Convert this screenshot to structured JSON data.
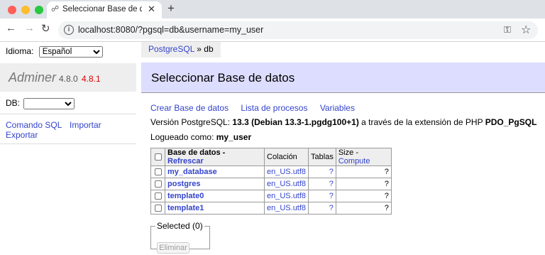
{
  "browser": {
    "tab_title": "Seleccionar Base de datos - d",
    "tab_close": "✕",
    "new_tab": "+",
    "url": "localhost:8080/?pgsql=db&username=my_user",
    "icons": [
      "back-icon",
      "forward-icon",
      "reload-icon",
      "site-info-icon",
      "key-icon",
      "bookmark-star-icon"
    ]
  },
  "menu": {
    "language_label": "Idioma:",
    "language_selected": "Español",
    "brand_name": "Adminer",
    "version_current": "4.8.0",
    "version_new": "4.8.1",
    "db_label": "DB:",
    "db_selected": "",
    "links": {
      "sql_command": "Comando SQL",
      "import": "Importar",
      "export": "Exportar"
    }
  },
  "breadcrumb": {
    "driver": "PostgreSQL",
    "separator": "»",
    "server": "db"
  },
  "main": {
    "title": "Seleccionar Base de datos",
    "links": {
      "create_db": "Crear Base de datos",
      "process_list": "Lista de procesos",
      "variables": "Variables"
    },
    "version_prefix": "Versión PostgreSQL:",
    "version_value": "13.3 (Debian 13.3-1.pgdg100+1)",
    "version_middle": "a través de la extensión de PHP",
    "version_ext": "PDO_PgSQL",
    "login_label": "Logueado como:",
    "login_user": "my_user"
  },
  "table": {
    "headers": {
      "database": "Base de datos",
      "dash": "-",
      "refresh": "Refrescar",
      "collation": "Colación",
      "tables": "Tablas",
      "size": "Size",
      "size_dash": "-",
      "compute": "Compute"
    },
    "rows": [
      {
        "name": "my_database",
        "collation": "en_US.utf8",
        "tables": "?",
        "size": "?"
      },
      {
        "name": "postgres",
        "collation": "en_US.utf8",
        "tables": "?",
        "size": "?"
      },
      {
        "name": "template0",
        "collation": "en_US.utf8",
        "tables": "?",
        "size": "?"
      },
      {
        "name": "template1",
        "collation": "en_US.utf8",
        "tables": "?",
        "size": "?"
      }
    ]
  },
  "selected": {
    "legend": "Selected (0)",
    "delete_button": "Eliminar"
  },
  "colors": {
    "link": "#3344cc",
    "header_bg": "#ddddff",
    "new_version": "#dd0000"
  }
}
